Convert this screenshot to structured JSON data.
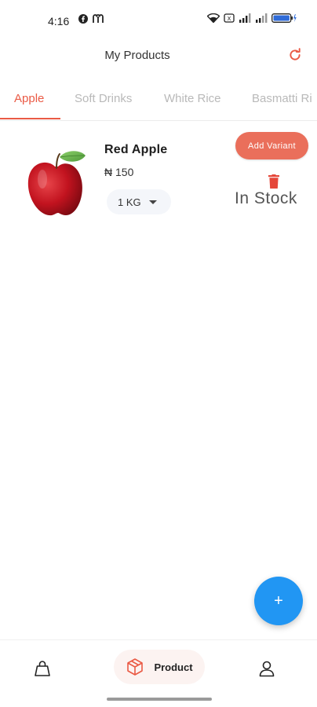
{
  "status_bar": {
    "time": "4:16",
    "icons": [
      "facebook-icon",
      "messenger-icon",
      "wifi-icon",
      "signal-icon",
      "signal-icon",
      "battery-icon"
    ]
  },
  "header": {
    "title": "My Products",
    "refresh_icon": "refresh-icon"
  },
  "tabs": [
    {
      "label": "Apple",
      "active": true
    },
    {
      "label": "Soft Drinks",
      "active": false
    },
    {
      "label": "White Rice",
      "active": false
    },
    {
      "label": "Basmatti Ri",
      "active": false
    }
  ],
  "product": {
    "name": "Red Apple",
    "price": "₦ 150",
    "variant": "1 KG",
    "add_variant_label": "Add Variant",
    "stock_status": "In Stock",
    "delete_icon": "trash-icon"
  },
  "fab": {
    "label": "+"
  },
  "bottom_nav": {
    "items": [
      {
        "icon": "shopping-bag-icon",
        "label": ""
      },
      {
        "icon": "package-icon",
        "label": "Product",
        "active": true
      },
      {
        "icon": "person-icon",
        "label": ""
      }
    ]
  },
  "colors": {
    "accent": "#ea5a45",
    "add_variant_bg": "#ea6f5b",
    "fab": "#2196f3",
    "inactive_tab": "#b9b9b9"
  }
}
